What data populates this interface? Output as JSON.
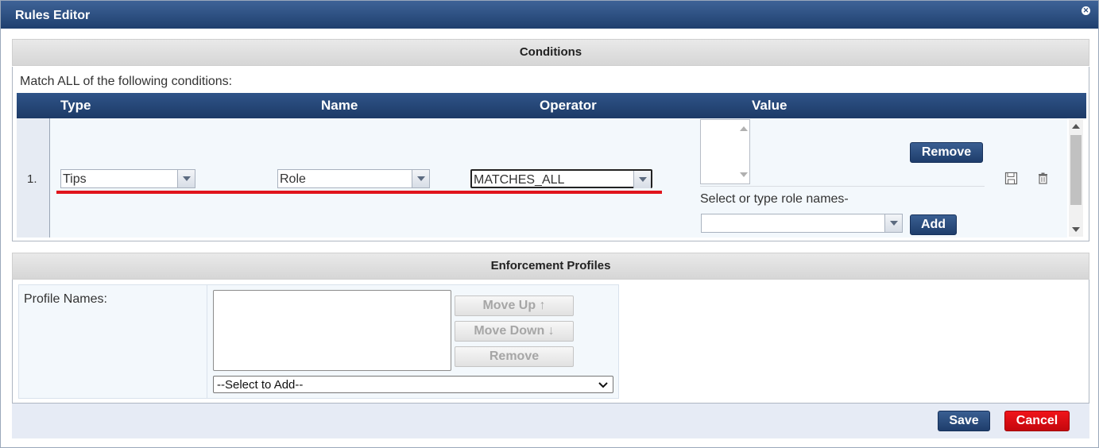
{
  "dialog": {
    "title": "Rules Editor"
  },
  "conditions": {
    "header": "Conditions",
    "match_label": "Match ALL of the following conditions:",
    "columns": {
      "type": "Type",
      "name": "Name",
      "operator": "Operator",
      "value": "Value"
    },
    "row": {
      "number": "1.",
      "type": "Tips",
      "name": "Role",
      "operator": "MATCHES_ALL",
      "remove_label": "Remove",
      "hint": "Select or type role names-",
      "add_label": "Add"
    }
  },
  "enforcement": {
    "header": "Enforcement Profiles",
    "profile_label": "Profile Names:",
    "move_up_label": "Move Up ↑",
    "move_down_label": "Move Down ↓",
    "remove_label": "Remove",
    "select_value": "--Select to Add--"
  },
  "footer": {
    "save_label": "Save",
    "cancel_label": "Cancel"
  },
  "colors": {
    "accent": "#1f3f6e",
    "cancel": "#e3090f",
    "highlight": "#e0141c"
  }
}
